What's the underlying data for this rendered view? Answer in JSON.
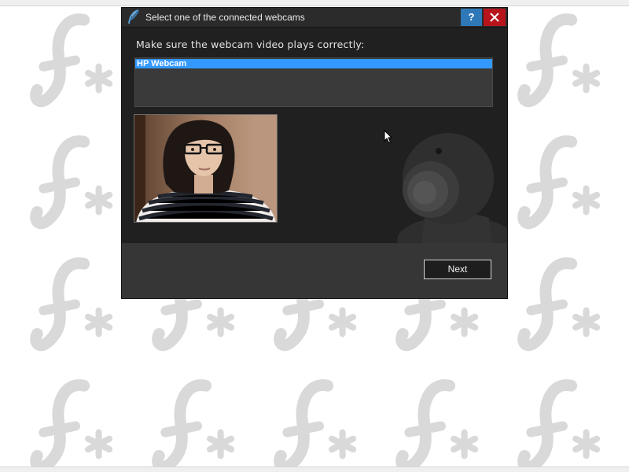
{
  "dialog": {
    "title": "Select one of the connected webcams",
    "help_label": "?",
    "instruction": "Make sure the webcam video plays correctly:",
    "webcams": [
      {
        "label": "HP Webcam",
        "selected": true
      }
    ],
    "next_label": "Next"
  },
  "colors": {
    "dialog_bg": "#202020",
    "footer_bg": "#363636",
    "selection": "#3399ff",
    "help_button": "#2f78b8",
    "close_button": "#b8141b",
    "desktop_bg": "#ffffff",
    "pattern_glyph": "#d9d9d9"
  },
  "icons": {
    "app": "feather-icon",
    "help": "help-icon",
    "close": "close-icon",
    "illustration": "webcam-icon",
    "cursor": "mouse-pointer-icon"
  }
}
